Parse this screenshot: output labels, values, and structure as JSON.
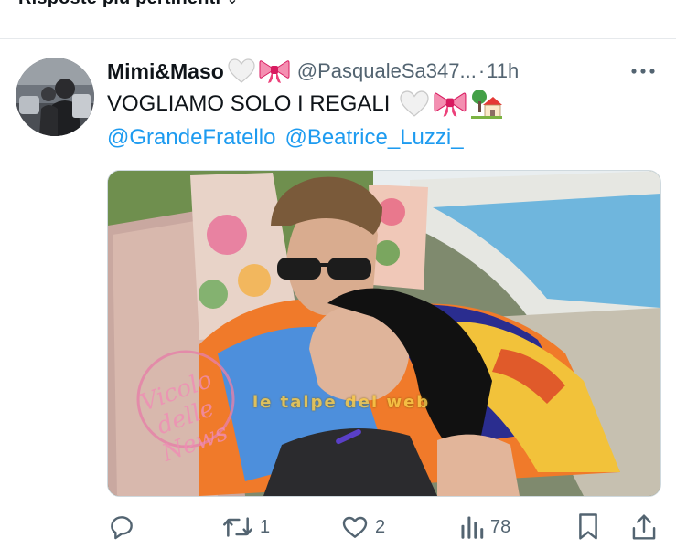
{
  "header_strip": {
    "label": "Risposte più pertinenti",
    "chevron": "⌄"
  },
  "tweet": {
    "display_name": "Mimi&Maso",
    "name_emojis": [
      "white-heart-icon",
      "ribbon-icon"
    ],
    "handle": "@PasqualeSa347...",
    "separator": "·",
    "time": "11h",
    "text": "VOGLIAMO SOLO I REGALI",
    "text_emojis": [
      "white-heart-icon",
      "ribbon-icon",
      "house-with-garden-icon"
    ],
    "mentions": [
      "@GrandeFratello",
      "@Beatrice_Luzzi_"
    ],
    "media": {
      "watermark_left": "Vicolo delle News",
      "watermark_center": "le talpe del web"
    },
    "actions": {
      "reply": {
        "icon": "reply-icon",
        "count": ""
      },
      "retweet": {
        "icon": "retweet-icon",
        "count": "1"
      },
      "like": {
        "icon": "heart-icon",
        "count": "2"
      },
      "views": {
        "icon": "views-icon",
        "count": "78"
      },
      "bookmark": {
        "icon": "bookmark-icon",
        "count": ""
      },
      "share": {
        "icon": "share-icon",
        "count": ""
      }
    }
  },
  "colors": {
    "text": "#0f1419",
    "secondary": "#536471",
    "link": "#1d9bf0",
    "border": "#cfd9de",
    "ribbon": "#f06292"
  }
}
